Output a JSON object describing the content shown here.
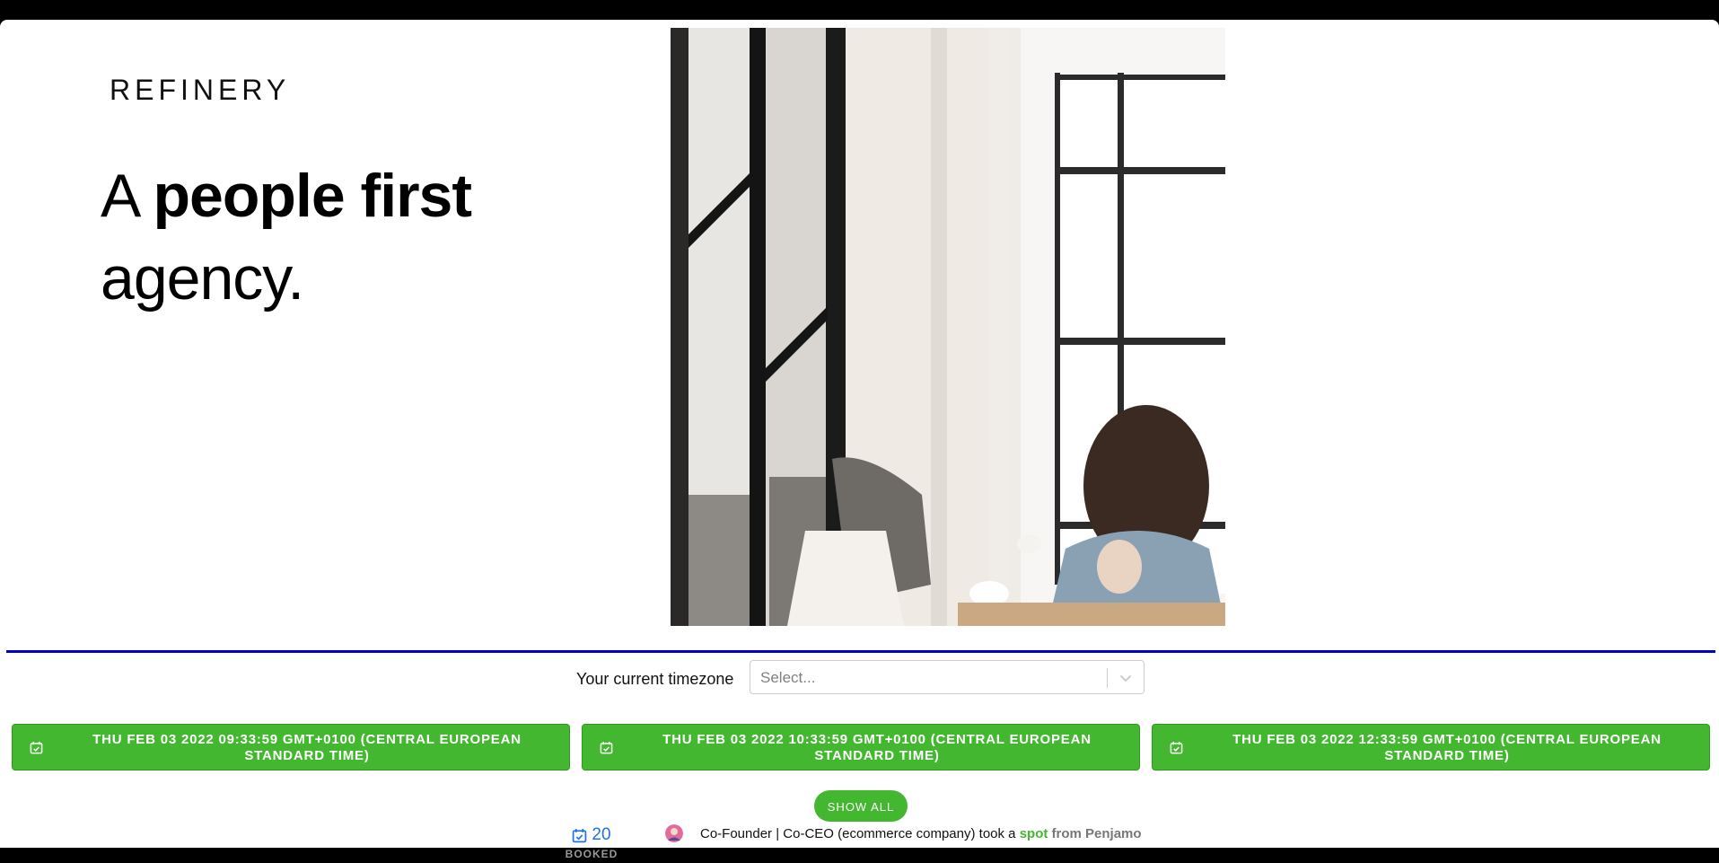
{
  "brand": {
    "logo_text": "REFINERY"
  },
  "headline": {
    "lead": "A",
    "bold": "people first",
    "rest": "agency."
  },
  "hero_image": {
    "description_icon": "hero-photo"
  },
  "timezone": {
    "label": "Your current timezone",
    "placeholder": "Select..."
  },
  "slots": [
    {
      "label": "Thu Feb 03 2022 09:33:59 GMT+0100 (Central European Standard Time)"
    },
    {
      "label": "Thu Feb 03 2022 10:33:59 GMT+0100 (Central European Standard Time)"
    },
    {
      "label": "Thu Feb 03 2022 12:33:59 GMT+0100 (Central European Standard Time)"
    }
  ],
  "show_all_label": "SHOW ALL",
  "booked": {
    "count": "20",
    "label": "BOOKED"
  },
  "activity": {
    "text": "Co-Founder | Co-CEO (ecommerce company) took a ",
    "spot": "spot",
    "source": " from Penjamo"
  },
  "colors": {
    "accent_green": "#43b72f",
    "divider_blue": "#0000c8",
    "booked_blue": "#1a73e8"
  }
}
